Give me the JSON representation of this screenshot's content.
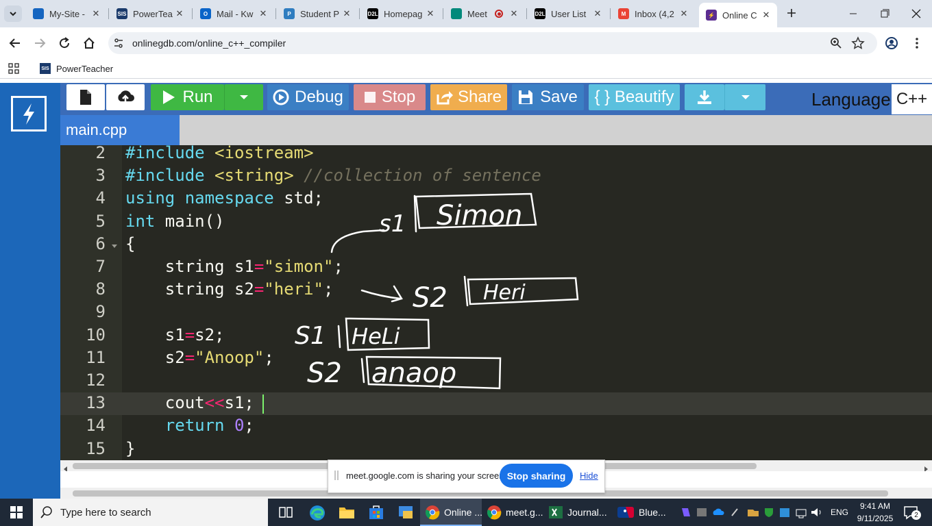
{
  "browser": {
    "tabs": [
      {
        "title": "My-Site -",
        "favicon_color": "#1565c0"
      },
      {
        "title": "PowerTea",
        "favicon_color": "#1a3a6b",
        "favicon_text": "SIS"
      },
      {
        "title": "Mail - Kw",
        "favicon_color": "#0a64c8",
        "favicon_text": "O"
      },
      {
        "title": "Student P",
        "favicon_color": "#2f7dc0",
        "favicon_text": "P"
      },
      {
        "title": "Homepag",
        "favicon_color": "#000000",
        "favicon_text": "D2L"
      },
      {
        "title": "Meet",
        "favicon_color": "#00897b"
      },
      {
        "title": "User List",
        "favicon_color": "#000000",
        "favicon_text": "D2L"
      },
      {
        "title": "Inbox (4,2",
        "favicon_color": "#ea4335",
        "favicon_text": "M"
      },
      {
        "title": "Online C",
        "favicon_color": "#5c2d91",
        "favicon_text": "⚡"
      }
    ],
    "url": "onlinegdb.com/online_c++_compiler",
    "bookmark": "PowerTeacher",
    "bookmark_icon_text": "SIS"
  },
  "toolbar": {
    "run": "Run",
    "debug": "Debug",
    "stop": "Stop",
    "share": "Share",
    "save": "Save",
    "beautify": "{ } Beautify",
    "language_label": "Language",
    "language_value": "C++"
  },
  "colors": {
    "run": "#3fb843",
    "debug": "#3b7fc4",
    "stop": "#d9898a",
    "share": "#f0ad4e",
    "save": "#3b7fc4",
    "beautify": "#5bc0de",
    "download": "#5bc0de"
  },
  "file_tab": "main.cpp",
  "code": {
    "line_numbers": [
      "2",
      "3",
      "4",
      "5",
      "6",
      "7",
      "8",
      "9",
      "10",
      "11",
      "12",
      "13",
      "14",
      "15"
    ],
    "lines": [
      {
        "parts": [
          [
            "kw",
            "#include"
          ],
          [
            "tx",
            " "
          ],
          [
            "st",
            "<iostream>"
          ]
        ]
      },
      {
        "parts": [
          [
            "kw",
            "#include"
          ],
          [
            "tx",
            " "
          ],
          [
            "st",
            "<string>"
          ],
          [
            "tx",
            " "
          ],
          [
            "cm",
            "//collection of sentence"
          ]
        ]
      },
      {
        "parts": [
          [
            "kw",
            "using"
          ],
          [
            "tx",
            " "
          ],
          [
            "kw",
            "namespace"
          ],
          [
            "tx",
            " std;"
          ]
        ]
      },
      {
        "parts": [
          [
            "kw",
            "int"
          ],
          [
            "tx",
            " main()"
          ]
        ]
      },
      {
        "parts": [
          [
            "tx",
            "{"
          ]
        ]
      },
      {
        "parts": [
          [
            "tx",
            "    string s1"
          ],
          [
            "op",
            "="
          ],
          [
            "st",
            "\"simon\""
          ],
          [
            "tx",
            ";"
          ]
        ]
      },
      {
        "parts": [
          [
            "tx",
            "    string s2"
          ],
          [
            "op",
            "="
          ],
          [
            "st",
            "\"heri\""
          ],
          [
            "tx",
            ";"
          ]
        ]
      },
      {
        "parts": [
          [
            "tx",
            ""
          ]
        ]
      },
      {
        "parts": [
          [
            "tx",
            "    s1"
          ],
          [
            "op",
            "="
          ],
          [
            "tx",
            "s2;"
          ]
        ]
      },
      {
        "parts": [
          [
            "tx",
            "    s2"
          ],
          [
            "op",
            "="
          ],
          [
            "st",
            "\"Anoop\""
          ],
          [
            "tx",
            ";"
          ]
        ]
      },
      {
        "parts": [
          [
            "tx",
            ""
          ]
        ]
      },
      {
        "parts": [
          [
            "tx",
            "    cout"
          ],
          [
            "op",
            "<<"
          ],
          [
            "tx",
            "s1;"
          ]
        ]
      },
      {
        "parts": [
          [
            "tx",
            "    "
          ],
          [
            "kw",
            "return"
          ],
          [
            "tx",
            " "
          ],
          [
            "nm",
            "0"
          ],
          [
            "tx",
            ";"
          ]
        ]
      },
      {
        "parts": [
          [
            "tx",
            "}"
          ]
        ]
      }
    ]
  },
  "annotations": {
    "s1_simon_label": "s1",
    "s1_simon_value": "Simon",
    "s2_heri_label": "S2",
    "s2_heri_value": "Heri",
    "s1_heri_label": "S1",
    "s1_heri_value": "HeLi",
    "s2_anoop_label": "S2",
    "s2_anoop_value": "anaop"
  },
  "share_banner": {
    "message": "meet.google.com is sharing your screen.",
    "stop": "Stop sharing",
    "hide": "Hide"
  },
  "taskbar": {
    "search_placeholder": "Type here to search",
    "apps": [
      {
        "label": "Online ..."
      },
      {
        "label": "meet.g..."
      },
      {
        "label": "Journal..."
      },
      {
        "label": "Blue..."
      }
    ],
    "language": "ENG",
    "time": "9:41 AM",
    "date": "9/11/2025",
    "notifications": "2"
  }
}
